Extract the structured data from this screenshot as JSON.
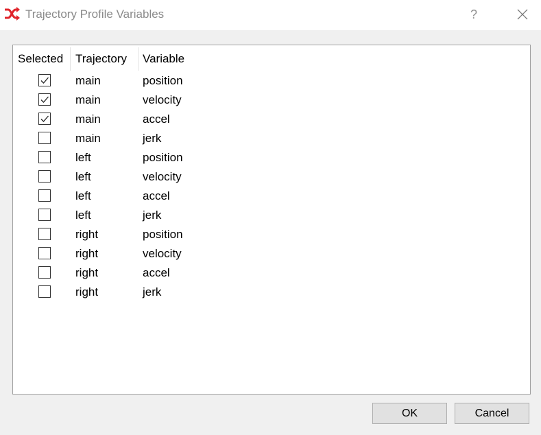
{
  "window": {
    "title": "Trajectory Profile Variables",
    "help_label": "?",
    "app_icon": "shuffle-icon",
    "accent_color": "#e0242b"
  },
  "table": {
    "columns": [
      "Selected",
      "Trajectory",
      "Variable"
    ],
    "rows": [
      {
        "selected": true,
        "trajectory": "main",
        "variable": "position"
      },
      {
        "selected": true,
        "trajectory": "main",
        "variable": "velocity"
      },
      {
        "selected": true,
        "trajectory": "main",
        "variable": "accel"
      },
      {
        "selected": false,
        "trajectory": "main",
        "variable": "jerk"
      },
      {
        "selected": false,
        "trajectory": "left",
        "variable": "position"
      },
      {
        "selected": false,
        "trajectory": "left",
        "variable": "velocity"
      },
      {
        "selected": false,
        "trajectory": "left",
        "variable": "accel"
      },
      {
        "selected": false,
        "trajectory": "left",
        "variable": "jerk"
      },
      {
        "selected": false,
        "trajectory": "right",
        "variable": "position"
      },
      {
        "selected": false,
        "trajectory": "right",
        "variable": "velocity"
      },
      {
        "selected": false,
        "trajectory": "right",
        "variable": "accel"
      },
      {
        "selected": false,
        "trajectory": "right",
        "variable": "jerk"
      }
    ]
  },
  "buttons": {
    "ok": "OK",
    "cancel": "Cancel"
  }
}
